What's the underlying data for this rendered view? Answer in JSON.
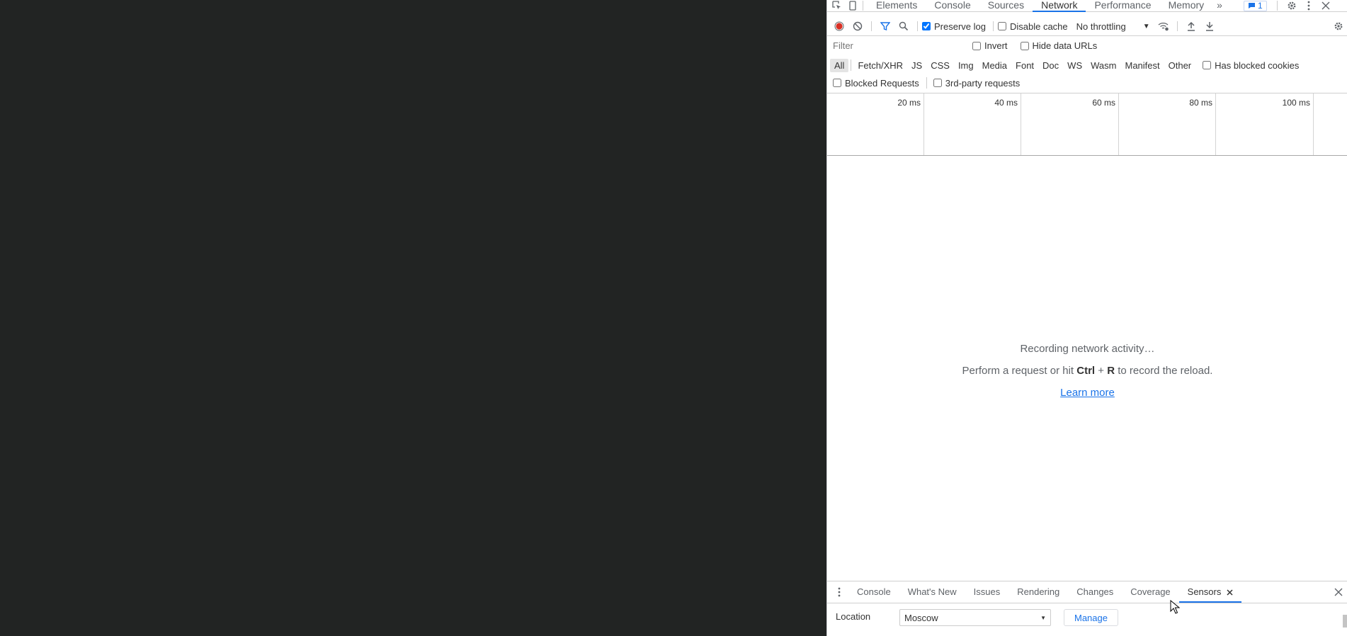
{
  "devtools": {
    "top_tabs": [
      "Elements",
      "Console",
      "Sources",
      "Network",
      "Performance",
      "Memory"
    ],
    "active_tab": "Network",
    "more_tabs_glyph": "»",
    "issues_count": "1",
    "toolbar": {
      "preserve_log": "Preserve log",
      "disable_cache": "Disable cache",
      "throttling": "No throttling"
    },
    "filter": {
      "placeholder": "Filter",
      "invert": "Invert",
      "hide_data_urls": "Hide data URLs"
    },
    "type_filters": [
      "All",
      "Fetch/XHR",
      "JS",
      "CSS",
      "Img",
      "Media",
      "Font",
      "Doc",
      "WS",
      "Wasm",
      "Manifest",
      "Other"
    ],
    "has_blocked_cookies": "Has blocked cookies",
    "blocked_requests": "Blocked Requests",
    "third_party_requests": "3rd-party requests",
    "timeline_ticks": [
      "20 ms",
      "40 ms",
      "60 ms",
      "80 ms",
      "100 ms"
    ],
    "empty_state": {
      "line1": "Recording network activity…",
      "line2_before": "Perform a request or hit ",
      "key_ctrl": "Ctrl",
      "plus": " + ",
      "key_r": "R",
      "line2_after": " to record the reload.",
      "learn_more": "Learn more"
    },
    "drawer": {
      "tabs": [
        "Console",
        "What's New",
        "Issues",
        "Rendering",
        "Changes",
        "Coverage",
        "Sensors"
      ],
      "active_tab": "Sensors",
      "location_label": "Location",
      "location_value": "Moscow",
      "manage": "Manage"
    }
  },
  "colors": {
    "page_background": "#222423",
    "accent": "#1a73e8",
    "record": "#d93025"
  }
}
